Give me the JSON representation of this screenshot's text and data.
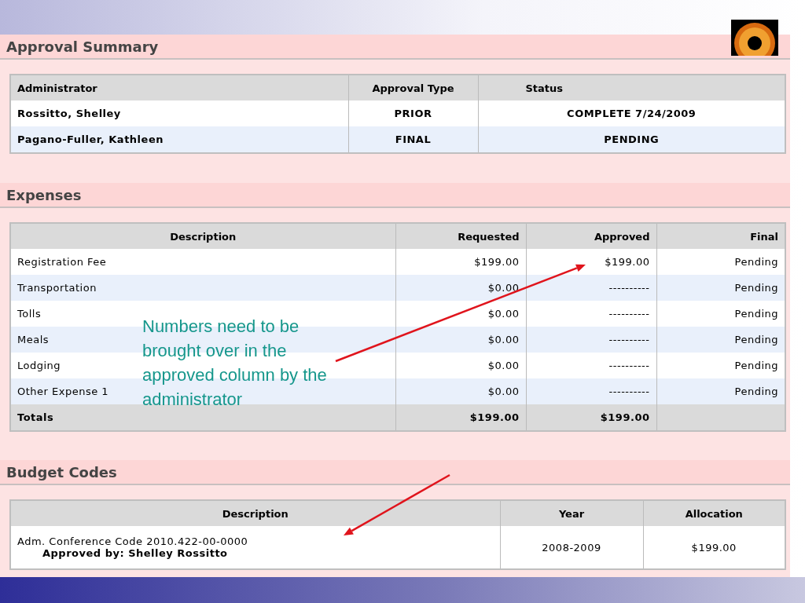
{
  "approval_summary": {
    "title": "Approval Summary",
    "columns": [
      "Administrator",
      "Approval Type",
      "Status"
    ],
    "rows": [
      {
        "administrator": "Rossitto, Shelley",
        "approval_type": "PRIOR",
        "status": "COMPLETE 7/24/2009"
      },
      {
        "administrator": "Pagano-Fuller, Kathleen",
        "approval_type": "FINAL",
        "status": "PENDING"
      }
    ]
  },
  "expenses": {
    "title": "Expenses",
    "columns": [
      "Description",
      "Requested",
      "Approved",
      "Final"
    ],
    "rows": [
      {
        "description": "Registration Fee",
        "requested": "$199.00",
        "approved": "$199.00",
        "final": "Pending"
      },
      {
        "description": "Transportation",
        "requested": "$0.00",
        "approved": "----------",
        "final": "Pending"
      },
      {
        "description": "Tolls",
        "requested": "$0.00",
        "approved": "----------",
        "final": "Pending"
      },
      {
        "description": "Meals",
        "requested": "$0.00",
        "approved": "----------",
        "final": "Pending"
      },
      {
        "description": "Lodging",
        "requested": "$0.00",
        "approved": "----------",
        "final": "Pending"
      },
      {
        "description": "Other Expense 1",
        "requested": "$0.00",
        "approved": "----------",
        "final": "Pending"
      }
    ],
    "totals": {
      "label": "Totals",
      "requested": "$199.00",
      "approved": "$199.00"
    }
  },
  "budget_codes": {
    "title": "Budget Codes",
    "columns": [
      "Description",
      "Year",
      "Allocation"
    ],
    "rows": [
      {
        "description": "Adm. Conference Code 2010.422-00-0000",
        "approved_by": "Approved by: Shelley Rossitto",
        "year": "2008-2009",
        "allocation": "$199.00"
      }
    ]
  },
  "annotation": "Numbers need to be brought over in the approved column by the administrator"
}
